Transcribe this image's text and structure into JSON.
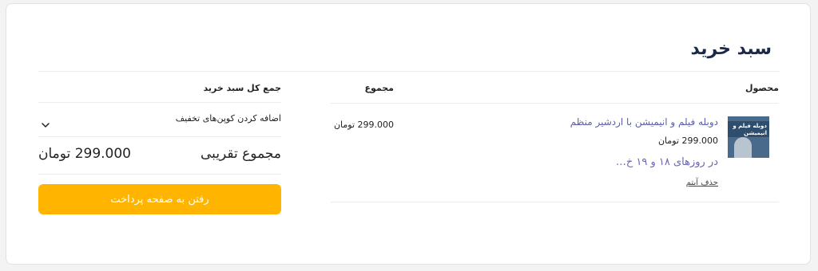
{
  "page": {
    "title": "سبد خرید"
  },
  "cart": {
    "columns": {
      "product": "محصول",
      "total": "مجموع"
    },
    "thumbnail": {
      "line1": "دوبله فیلم و",
      "line2": "انیمیشن"
    },
    "item": {
      "name": "دوبله فیلم و انیمیشن با اردشیر منظم",
      "price": "299.000 تومان",
      "note": "در روزهای ۱۸ و ۱۹ خ…",
      "remove": "حذف آیتم",
      "total": "299.000 تومان"
    }
  },
  "summary": {
    "heading": "جمع کل سبد خرید",
    "coupon_label": "اضافه کردن کوپن‌های تخفیف",
    "subtotal_label": "مجموع تقریبی",
    "subtotal_value": "299.000 تومان",
    "checkout_label": "رفتن به صفحه پرداخت"
  },
  "colors": {
    "accent": "#ffb500",
    "link": "#5a5fa8",
    "title": "#1b2a4a"
  },
  "icons": {
    "coupon_toggle": "chevron-down-icon"
  }
}
